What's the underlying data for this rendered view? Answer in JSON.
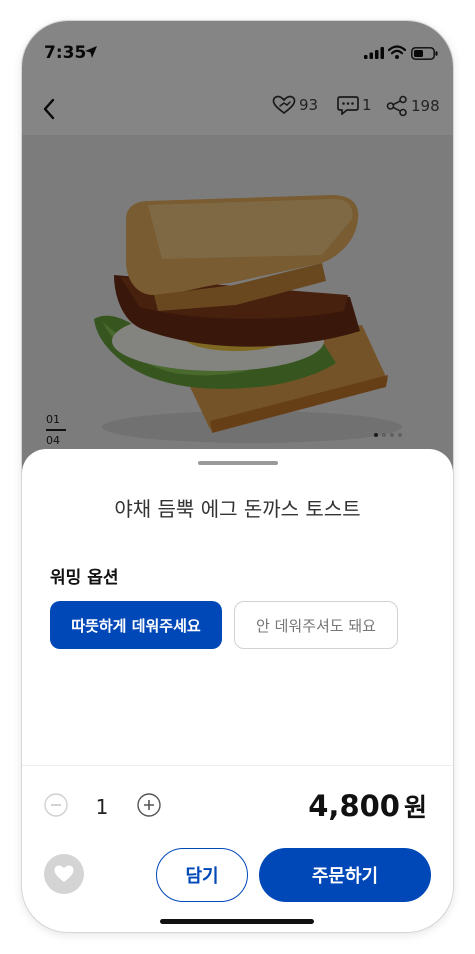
{
  "status_bar": {
    "time": "7:35"
  },
  "header": {
    "likes": "93",
    "comments": "1",
    "shares": "198"
  },
  "gallery": {
    "current": "01",
    "total": "04",
    "dot_count": 4,
    "active_dot": 0
  },
  "sheet": {
    "product_title": "야채 듬뿍 에그 돈까스 토스트",
    "option_label": "워밍 옵션",
    "options": [
      {
        "label": "따뜻하게 데워주세요",
        "selected": true
      },
      {
        "label": "안 데워주셔도 돼요",
        "selected": false
      }
    ],
    "quantity": "1",
    "price": "4,800",
    "currency": "원",
    "cart_label": "담기",
    "order_label": "주문하기"
  },
  "colors": {
    "accent": "#0047b8"
  }
}
